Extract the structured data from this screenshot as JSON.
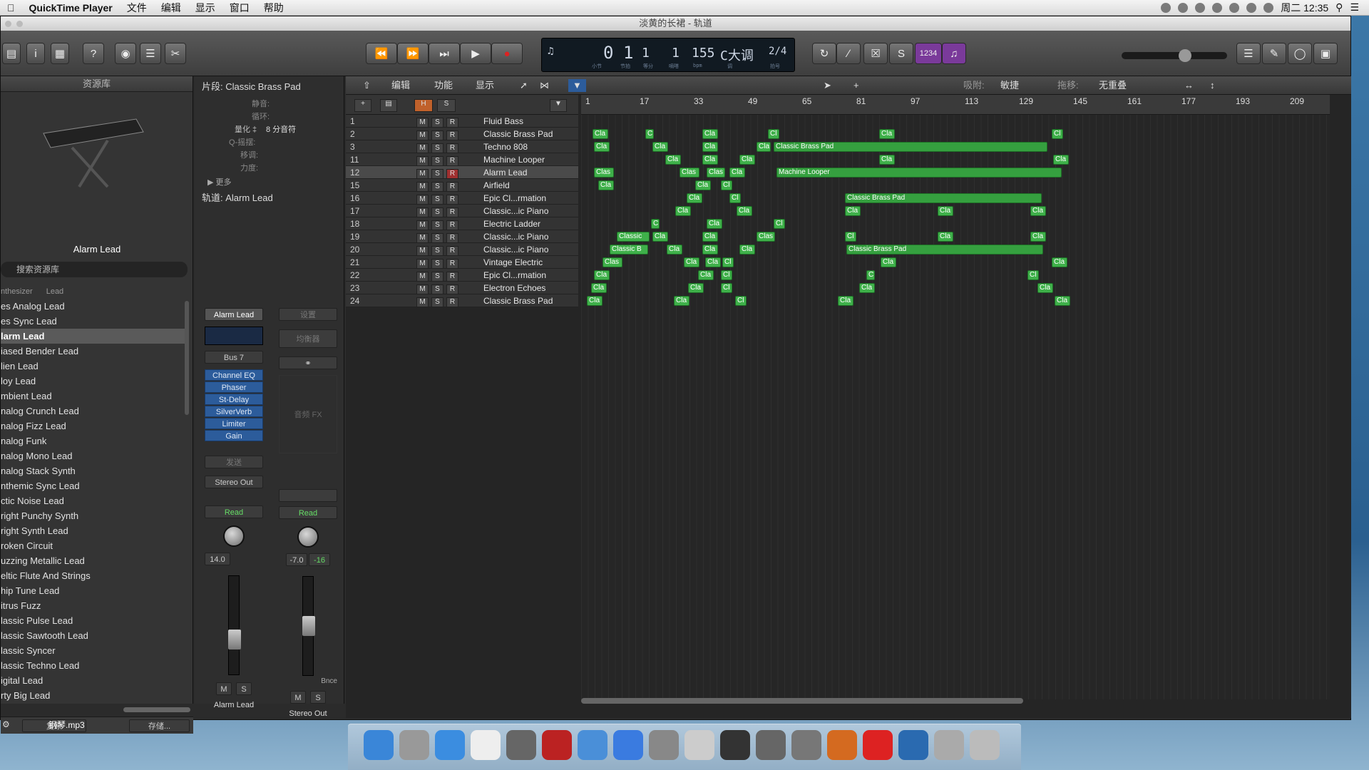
{
  "menubar": {
    "app_name": "QuickTime Player",
    "menus": [
      "文件",
      "编辑",
      "显示",
      "窗口",
      "帮助"
    ],
    "clock": "周二 12:35"
  },
  "window": {
    "title": "淡黄的长裙 - 轨道"
  },
  "transport": {
    "bar": "0",
    "beat": "1",
    "division": "1",
    "tick": "1",
    "tempo": "155",
    "key": "C大调",
    "signature": "2/4",
    "sublabels": [
      "小节",
      "节拍",
      "等分",
      "嘀嗒",
      "bpm",
      "调",
      "拍号"
    ],
    "cycle_counter": "1234"
  },
  "library": {
    "title": "资源库",
    "preview_name": "Alarm Lead",
    "search_placeholder": "搜索资源库",
    "path": [
      "nthesizer",
      "Lead"
    ],
    "items": [
      "es Analog Lead",
      "es Sync Lead",
      "larm Lead",
      "iased Bender Lead",
      "lien Lead",
      "loy Lead",
      "mbient Lead",
      "nalog Crunch Lead",
      "nalog Fizz Lead",
      "nalog Funk",
      "nalog Mono Lead",
      "nalog Stack Synth",
      "nthemic Sync Lead",
      "ctic Noise Lead",
      "right Punchy Synth",
      "right Synth Lead",
      "roken Circuit",
      "uzzing Metallic Lead",
      "eltic Flute And Strings",
      "hip Tune Lead",
      "itrus Fuzz",
      "lassic Pulse Lead",
      "lassic Sawtooth Lead",
      "lassic Syncer",
      "lassic Techno Lead",
      "igital Lead",
      "rty Big Lead"
    ],
    "selected_index": 2,
    "revert_label": "复原",
    "save_label": "存储..."
  },
  "inspector": {
    "region_title": "片段: Classic Brass Pad",
    "mute_label": "静音:",
    "loop_label": "循环:",
    "quantize_label": "量化 ‡",
    "quantize_value": "8 分音符",
    "q_swing_label": "Q-摇摆:",
    "transpose_label": "移调:",
    "velocity_label": "力度:",
    "more_label": "▶ 更多",
    "track_title": "轨道:  Alarm Lead",
    "strip1": {
      "instrument": "Alarm Lead",
      "bus": "Bus 7",
      "plugins": [
        "Channel EQ",
        "Phaser",
        "St-Delay",
        "SilverVerb",
        "Limiter",
        "Gain"
      ],
      "send_label": "发送",
      "output": "Stereo Out",
      "automation": "Read",
      "pan_value": "14.0",
      "name": "Alarm Lead"
    },
    "strip2": {
      "setting": "设置",
      "eq_label": "均衡器",
      "fx_label": "音频 FX",
      "automation": "Read",
      "volume": "-7.0",
      "peak": "-16",
      "bounce": "Bnce",
      "name": "Stereo Out"
    },
    "m_label": "M",
    "s_label": "S"
  },
  "arrange": {
    "menus": [
      "编辑",
      "功能",
      "显示"
    ],
    "snap_label": "吸附:",
    "snap_value": "敏捷",
    "drag_label": "拖移:",
    "drag_value": "无重叠",
    "ruler": [
      "1",
      "17",
      "33",
      "49",
      "65",
      "81",
      "97",
      "113",
      "129",
      "145",
      "161",
      "177",
      "193",
      "209"
    ],
    "header_buttons": [
      "+",
      "H",
      "S"
    ],
    "tracks": [
      {
        "num": "1",
        "name": "Fluid Bass"
      },
      {
        "num": "2",
        "name": "Classic Brass Pad"
      },
      {
        "num": "3",
        "name": "Techno 808"
      },
      {
        "num": "11",
        "name": "Machine Looper"
      },
      {
        "num": "12",
        "name": "Alarm Lead"
      },
      {
        "num": "15",
        "name": "Airfield"
      },
      {
        "num": "16",
        "name": "Epic Cl...rmation"
      },
      {
        "num": "17",
        "name": "Classic...ic Piano"
      },
      {
        "num": "18",
        "name": "Electric Ladder"
      },
      {
        "num": "19",
        "name": "Classic...ic Piano"
      },
      {
        "num": "20",
        "name": "Classic...ic Piano"
      },
      {
        "num": "21",
        "name": "Vintage Electric"
      },
      {
        "num": "22",
        "name": "Epic Cl...rmation"
      },
      {
        "num": "23",
        "name": "Electron Echoes"
      },
      {
        "num": "24",
        "name": "Classic Brass Pad"
      }
    ],
    "selected_track": 4,
    "region_labels": {
      "short": "Cla",
      "brass": "Classic Brass Pad",
      "looper": "Machine Looper",
      "classic": "Classic",
      "classic_b": "Classic B",
      "clas": "Clas",
      "c": "C",
      "cl": "Cl"
    }
  },
  "desktop_file": "钢琴.mp3",
  "colors": {
    "region_green": "#3fb04a",
    "record_red": "#c0392b",
    "plugin_blue": "#2c5c9b"
  }
}
